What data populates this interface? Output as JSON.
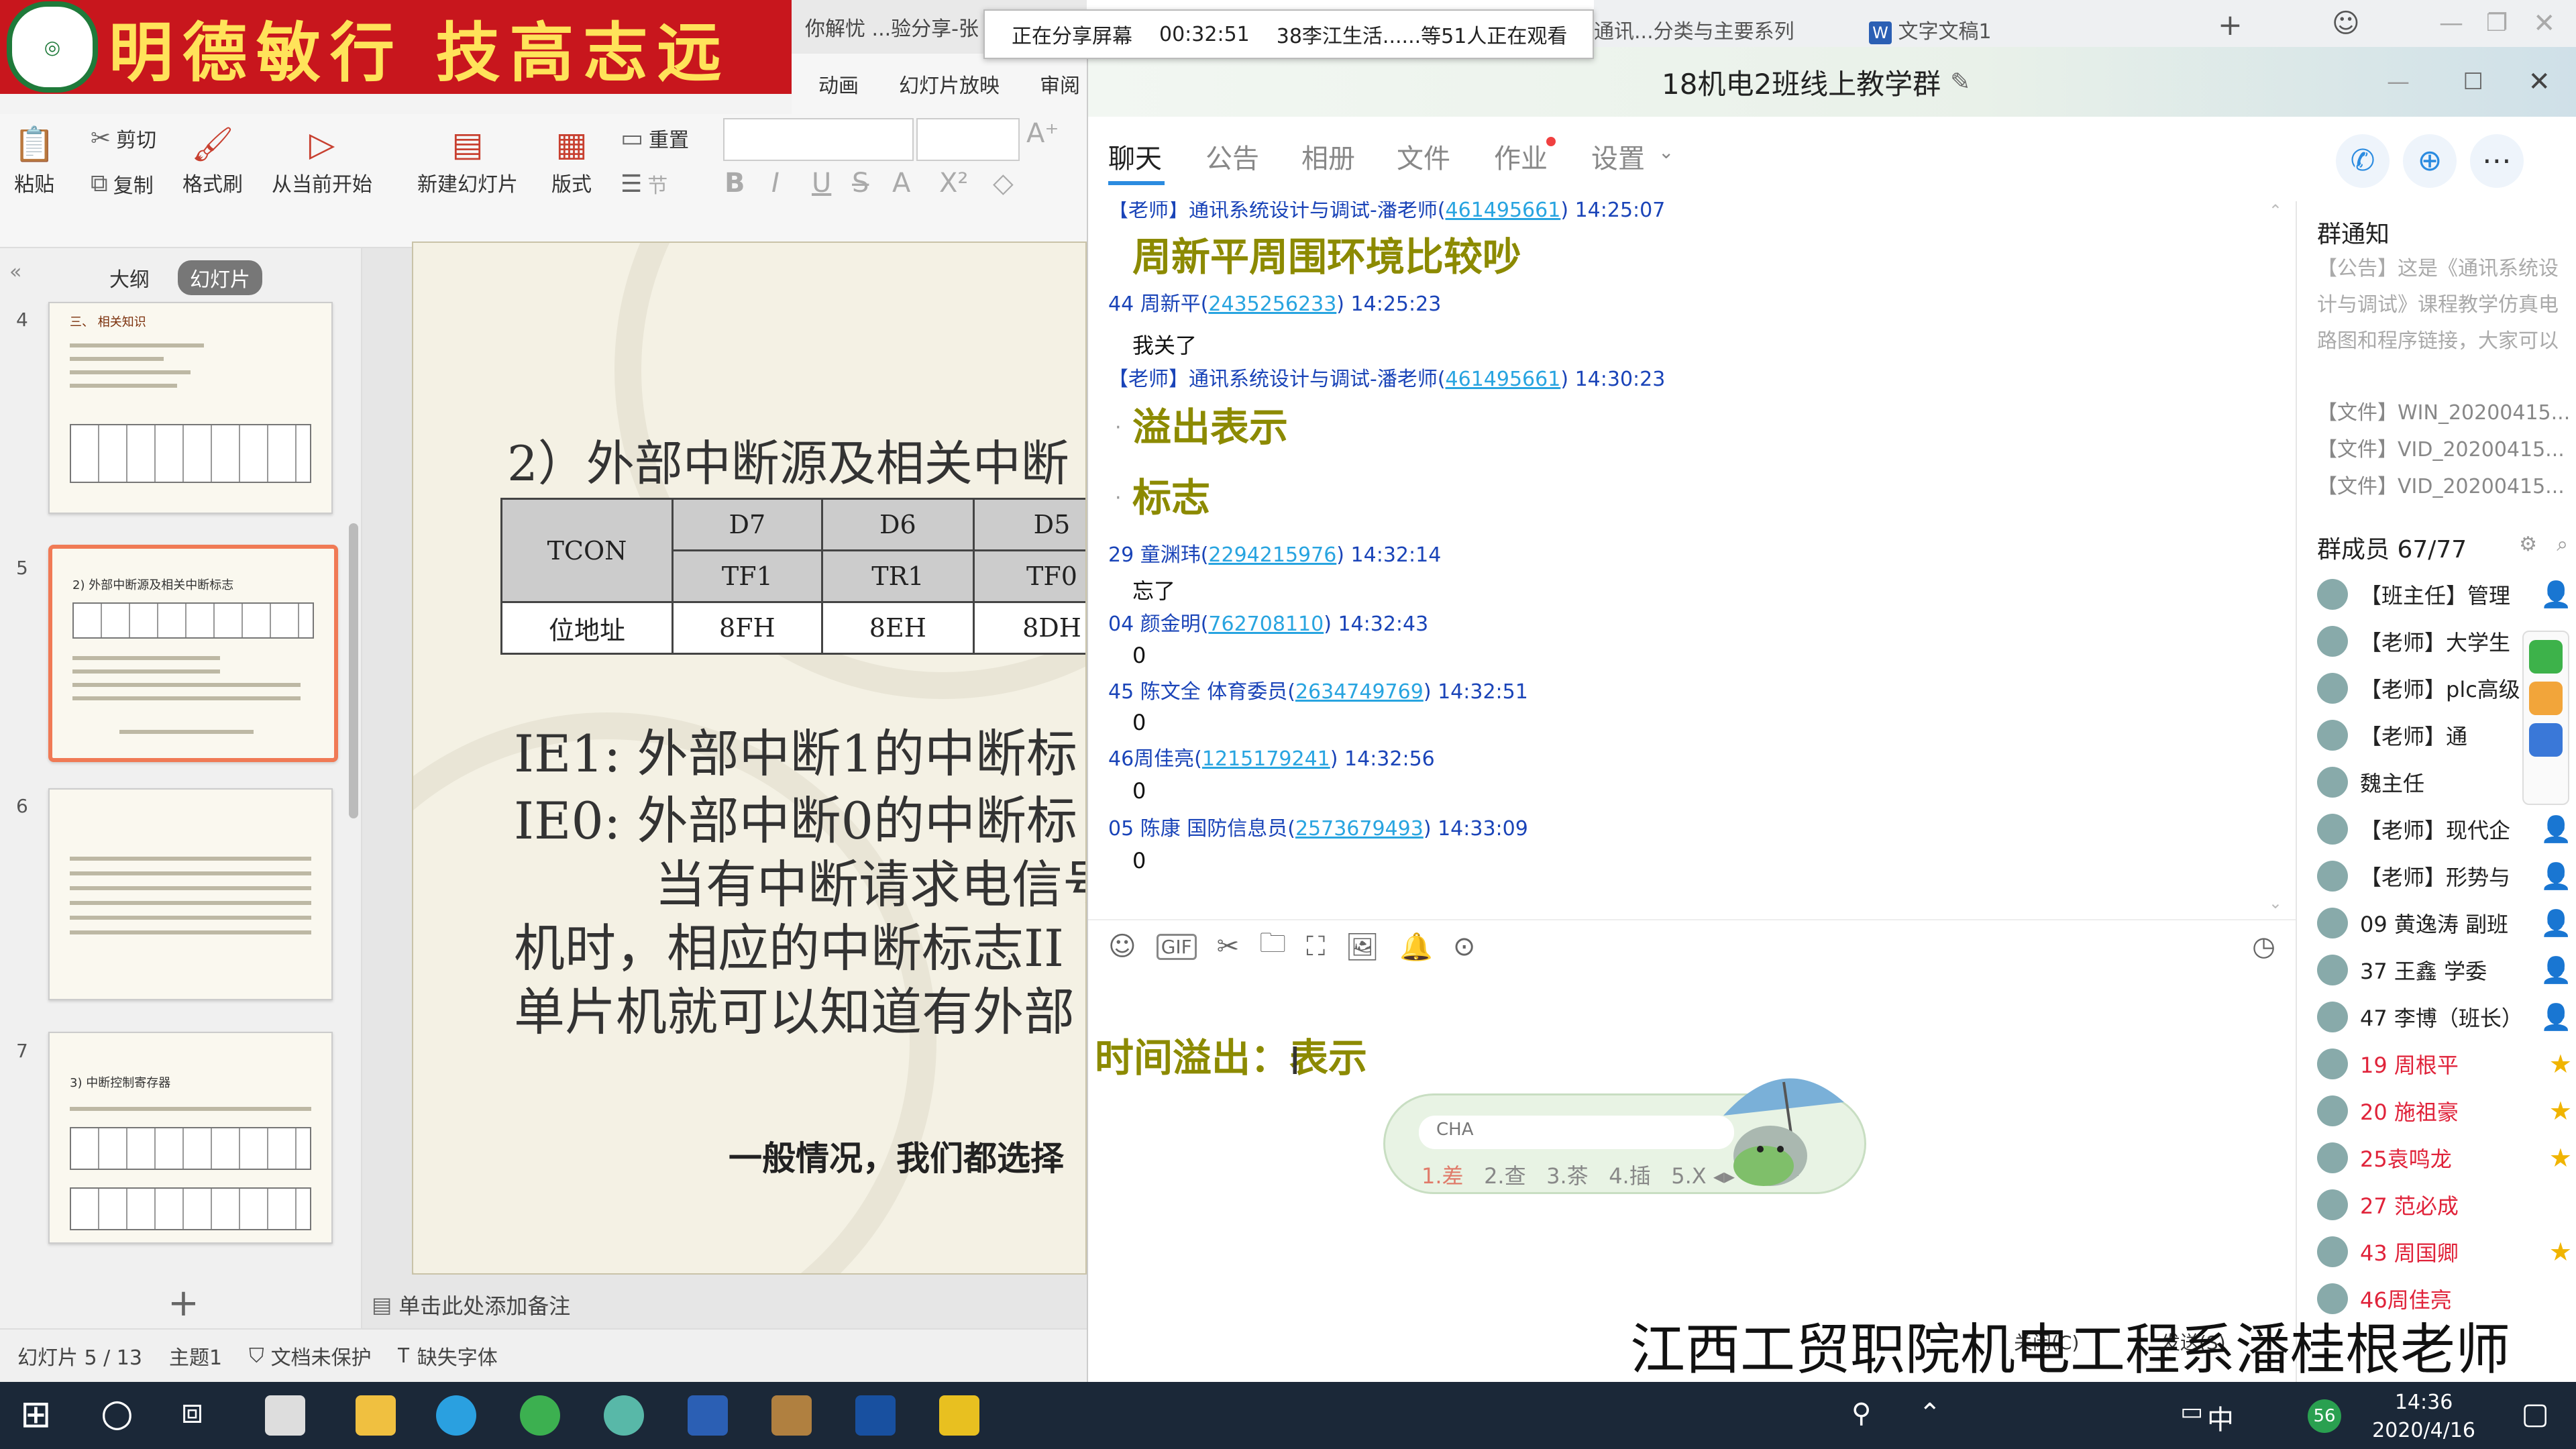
{
  "colors": {
    "accent_red": "#c8161d",
    "olive_text": "#8c8a00",
    "link_blue": "#28a4e0",
    "msg_blue": "#1a44b8",
    "member_red": "#e0233a"
  },
  "banner": {
    "text": "明德敏行 技高志远"
  },
  "ppt": {
    "doc_tab": "你解忧 ...验分享-张",
    "menu_tabs": [
      "动画",
      "幻灯片放映",
      "审阅"
    ],
    "ribbon": {
      "paste": "粘贴",
      "cut": "剪切",
      "copy": "复制",
      "format_painter": "格式刷",
      "play_from_current": "从当前开始",
      "new_slide": "新建幻灯片",
      "layout": "版式",
      "reset": "重置",
      "section": "节"
    },
    "panel_tabs": {
      "outline": "大纲",
      "slides": "幻灯片"
    },
    "thumb_numbers": [
      "4",
      "5",
      "6",
      "7"
    ],
    "thumb_titles": [
      "三、 相关知识",
      "2) 外部中断源及相关中断标志",
      "",
      "3) 中断控制寄存器"
    ],
    "slide": {
      "title": "2）外部中断源及相关中断",
      "table": {
        "row1": [
          "TCON",
          "D7",
          "D6",
          "D5"
        ],
        "row2": [
          "TF1",
          "TR1",
          "TF0"
        ],
        "row3": [
          "位地址",
          "8FH",
          "8EH",
          "8DH"
        ]
      },
      "lines": [
        "IE1:   外部中断1的中断标",
        "IE0:   外部中断0的中断标",
        "当有中断请求电信号",
        "机时，相应的中断标志II",
        "单片机就可以知道有外部"
      ],
      "footer": "一般情况，我们都选择"
    },
    "notes": "单击此处添加备注",
    "status": {
      "slide_count": "幻灯片 5 / 13",
      "theme": "主题1",
      "protect": "文档未保护",
      "font_missing": "缺失字体"
    }
  },
  "share_banner": {
    "status": "正在分享屏幕",
    "timer": "00:32:51",
    "viewers": "38李江生活......等51人正在观看"
  },
  "browser_tabs": [
    "通讯...分类与主要系列",
    "文字文稿1"
  ],
  "qq": {
    "title": "18机电2班线上教学群",
    "tabs": [
      "聊天",
      "公告",
      "相册",
      "文件",
      "作业",
      "设置"
    ],
    "messages": [
      {
        "type": "head",
        "who": "【老师】通讯系统设计与调试-潘老师(",
        "qq": "461495661",
        ")": ")",
        "time": "14:25:07"
      },
      {
        "type": "big",
        "text": "周新平周围环境比较吵"
      },
      {
        "type": "head",
        "who": "44  周新平(",
        "qq": "2435256233",
        "time": "14:25:23"
      },
      {
        "type": "text",
        "text": "我关了"
      },
      {
        "type": "head",
        "who": "【老师】通讯系统设计与调试-潘老师(",
        "qq": "461495661",
        "time": "14:30:23"
      },
      {
        "type": "big",
        "text": "溢出表示"
      },
      {
        "type": "big",
        "text": "标志"
      },
      {
        "type": "head",
        "who": "29 童渊玮(",
        "qq": "2294215976",
        "time": "14:32:14"
      },
      {
        "type": "text",
        "text": "忘了"
      },
      {
        "type": "head",
        "who": "04  颜金明(",
        "qq": "762708110",
        "time": "14:32:43"
      },
      {
        "type": "text",
        "text": "0"
      },
      {
        "type": "head",
        "who": "45  陈文全  体育委员(",
        "qq": "2634749769",
        "time": "14:32:51"
      },
      {
        "type": "text",
        "text": "0"
      },
      {
        "type": "head",
        "who": "46周佳亮(",
        "qq": "1215179241",
        "time": "14:32:56"
      },
      {
        "type": "text",
        "text": "0"
      },
      {
        "type": "head",
        "who": "05 陈康 国防信息员(",
        "qq": "2573679493",
        "time": "14:33:09"
      },
      {
        "type": "text",
        "text": "0"
      }
    ],
    "input_text": "时间溢出：表示",
    "ime": {
      "input": "CHA",
      "candidates": [
        "1.差",
        "2.查",
        "3.茶",
        "4.插",
        "5.X"
      ]
    },
    "notice": {
      "title": "群通知",
      "text": "【公告】这是《通讯系统设计与调试》课程教学仿真电路图和程序链接，大家可以下载观看哦，有利...",
      "files": [
        "【文件】WIN_20200415...",
        "【文件】VID_20200415...",
        "【文件】VID_20200415..."
      ]
    },
    "members_title": "群成员 67/77",
    "members": [
      {
        "name": "【班主任】管理",
        "red": false,
        "role": "👤"
      },
      {
        "name": "【老师】大学生",
        "red": false,
        "role": ""
      },
      {
        "name": "【老师】plc高级",
        "red": false,
        "role": ""
      },
      {
        "name": "【老师】通",
        "red": false,
        "role": "✎"
      },
      {
        "name": "魏主任",
        "red": false,
        "role": ""
      },
      {
        "name": "【老师】现代企",
        "red": false,
        "role": "👤"
      },
      {
        "name": "【老师】形势与",
        "red": false,
        "role": "👤"
      },
      {
        "name": "09 黄逸涛 副班",
        "red": false,
        "role": "👤"
      },
      {
        "name": "37 王鑫 学委",
        "red": false,
        "role": "👤"
      },
      {
        "name": "47 李博（班长）",
        "red": false,
        "role": "👤"
      },
      {
        "name": "19 周根平",
        "red": true,
        "role": "★"
      },
      {
        "name": "20 施祖豪",
        "red": true,
        "role": "★"
      },
      {
        "name": "25袁鸣龙",
        "red": true,
        "role": "★"
      },
      {
        "name": "27 范必成",
        "red": true,
        "role": ""
      },
      {
        "name": "43 周国卿",
        "red": true,
        "role": "★"
      },
      {
        "name": "46周佳亮",
        "red": true,
        "role": ""
      }
    ],
    "bottom_buttons": {
      "close": "关闭(C)",
      "send": "发送(S)"
    }
  },
  "watermark": "江西工贸职院机电工程系潘桂根老师",
  "taskbar": {
    "time": "14:36",
    "date": "2020/4/16",
    "ime": "中",
    "badge": "56"
  }
}
